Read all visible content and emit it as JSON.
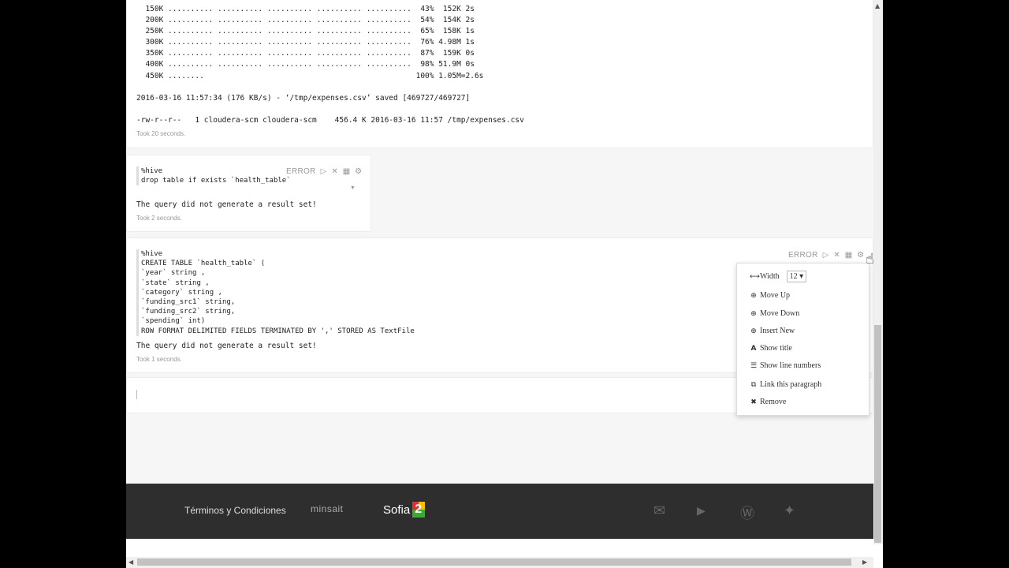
{
  "para1": {
    "log_lines": [
      "  150K .......... .......... .......... .......... ..........  43%  152K 2s",
      "  200K .......... .......... .......... .......... ..........  54%  154K 2s",
      "  250K .......... .......... .......... .......... ..........  65%  158K 1s",
      "  300K .......... .......... .......... .......... ..........  76% 4.98M 1s",
      "  350K .......... .......... .......... .......... ..........  87%  159K 0s",
      "  400K .......... .......... .......... .......... ..........  98% 51.9M 0s",
      "  450K ........                                               100% 1.05M=2.6s",
      "",
      "2016-03-16 11:57:34 (176 KB/s) - ‘/tmp/expenses.csv’ saved [469727/469727]",
      "",
      "-rw-r--r--   1 cloudera-scm cloudera-scm    456.4 K 2016-03-16 11:57 /tmp/expenses.csv"
    ],
    "took": "Took 20 seconds."
  },
  "para2": {
    "code": "%hive\ndrop table if exists `health_table`",
    "status": "ERROR",
    "message": "The query did not generate a result set!",
    "took": "Took 2 seconds."
  },
  "para3": {
    "code": "%hive\nCREATE TABLE `health_table` (\n`year` string ,\n`state` string ,\n`category` string ,\n`funding_src1` string,\n`funding_src2` string,\n`spending` int)\nROW FORMAT DELIMITED FIELDS TERMINATED BY ',' STORED AS TextFile",
    "status": "ERROR",
    "message": "The query did not generate a result set!",
    "took": "Took 1 seconds."
  },
  "menu": {
    "width_label": "Width",
    "width_value": "12",
    "items": [
      "Move Up",
      "Move Down",
      "Insert New",
      "Show title",
      "Show line numbers",
      "Link this paragraph",
      "Remove"
    ]
  },
  "footer": {
    "terms": "Términos y Condiciones",
    "brand1": "minsait",
    "brand2": "Sofia",
    "brand2_badge": "2"
  },
  "colors": {
    "footer_bg": "#2e2e2e",
    "badge_red": "#e2312d",
    "badge_yellow": "#f3c100",
    "badge_green": "#3aaa35"
  }
}
